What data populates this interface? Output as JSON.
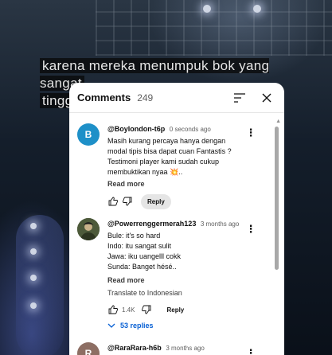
{
  "video": {
    "subtitle_line1": "karena mereka menumpuk bok yang sangat",
    "subtitle_line2": "tinggi"
  },
  "comments_panel": {
    "title": "Comments",
    "count": "249",
    "sort_icon": "sort-icon",
    "close_icon": "close-icon"
  },
  "comments": [
    {
      "avatar_letter": "B",
      "avatar_color": "#1e90c8",
      "author": "@Boylondon-t6p",
      "time": "0 seconds ago",
      "lines": [
        "Masih kurang percaya hanya dengan",
        "modal tipis bisa dapat cuan Fantastis ?",
        "Testimoni player kami sudah cukup",
        "membuktikan nyaa 💥.."
      ],
      "read_more": "Read more",
      "reply_label": "Reply",
      "likes": ""
    },
    {
      "avatar_letter": "",
      "avatar_color": "#3f4a2e",
      "author": "@Powerrenggermerah123",
      "time": "3 months ago",
      "lines": [
        "Bule: it's so hard",
        "Indo: itu sangat sulit",
        "Jawa: iku uangelll cokk",
        "Sunda: Banget hésé.."
      ],
      "read_more": "Read more",
      "translate": "Translate to Indonesian",
      "likes": "1.4K",
      "reply_label": "Reply",
      "replies_label": "53 replies"
    },
    {
      "avatar_letter": "R",
      "avatar_color": "#8d6e63",
      "author": "@RaraRara-h6b",
      "time": "3 months ago"
    }
  ]
}
